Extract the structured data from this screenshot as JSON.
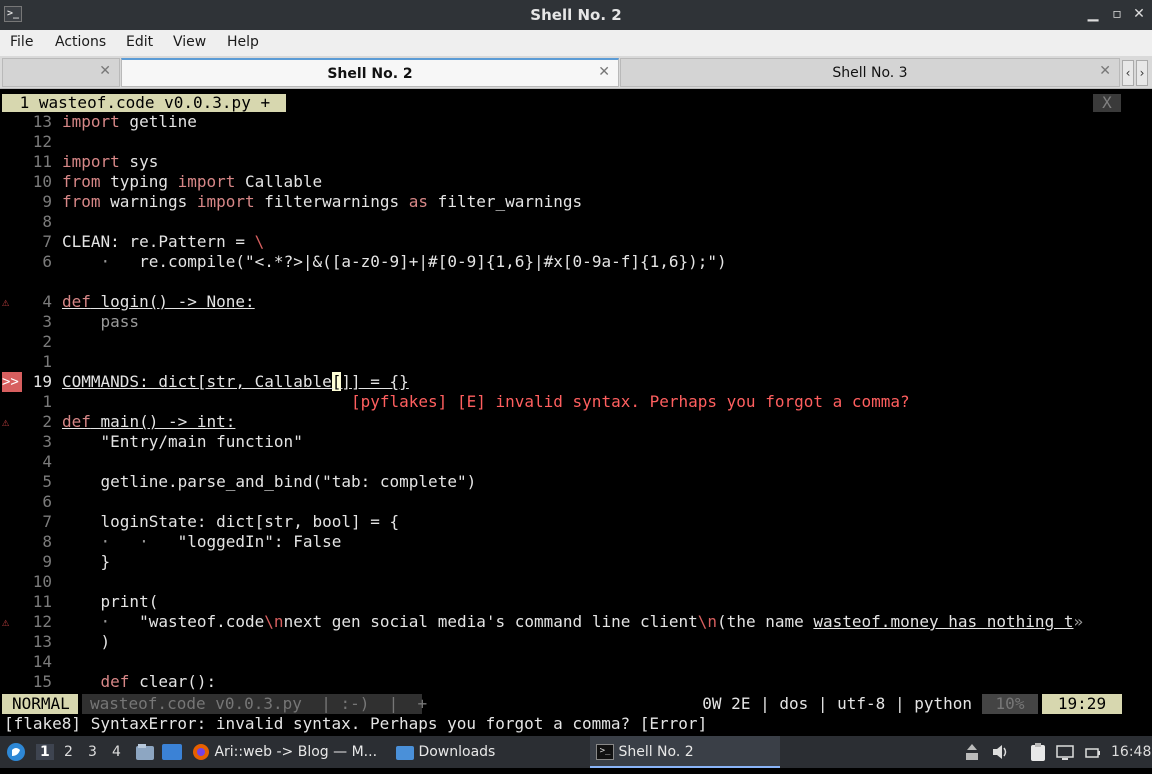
{
  "window": {
    "title": "Shell No. 2"
  },
  "menu": [
    "File",
    "Actions",
    "Edit",
    "View",
    "Help"
  ],
  "tabs": [
    {
      "label": ""
    },
    {
      "label": "Shell No. 2"
    },
    {
      "label": "Shell No. 3"
    }
  ],
  "vim": {
    "bufferline": " 1 wasteof.code v0.0.3.py + ",
    "close_label": "X",
    "lines": [
      {
        "ln": "13",
        "code": "import getline"
      },
      {
        "ln": "12",
        "code": ""
      },
      {
        "ln": "11",
        "code": "import sys"
      },
      {
        "ln": "10",
        "code": "from typing import Callable"
      },
      {
        "ln": "9",
        "code": "from warnings import filterwarnings as filter_warnings"
      },
      {
        "ln": "8",
        "code": ""
      },
      {
        "ln": "7",
        "code": "CLEAN: re.Pattern = \\"
      },
      {
        "ln": "6",
        "code": "    ·   re.compile(\"<.*?>|&([a-z0-9]+|#[0-9]{1,6}|#x[0-9a-f]{1,6});\")"
      },
      {
        "ln": "4",
        "code": "def login() -> None:"
      },
      {
        "ln": "3",
        "code": "    pass"
      },
      {
        "ln": "2",
        "code": ""
      },
      {
        "ln": "1",
        "code": ""
      },
      {
        "ln": "19",
        "code": "COMMANDS: dict[str, Callable[]] = {}"
      },
      {
        "ln": "1",
        "code": "                              [pyflakes] [E] invalid syntax. Perhaps you forgot a comma?"
      },
      {
        "ln": "2",
        "code": "def main() -> int:"
      },
      {
        "ln": "3",
        "code": "    \"\"\"Entry/main function\"\"\""
      },
      {
        "ln": "4",
        "code": ""
      },
      {
        "ln": "5",
        "code": "    getline.parse_and_bind(\"tab: complete\")"
      },
      {
        "ln": "6",
        "code": ""
      },
      {
        "ln": "7",
        "code": "    loginState: dict[str, bool] = {"
      },
      {
        "ln": "8",
        "code": "    ·   ·   \"loggedIn\": False"
      },
      {
        "ln": "9",
        "code": "    }"
      },
      {
        "ln": "10",
        "code": ""
      },
      {
        "ln": "11",
        "code": "    print("
      },
      {
        "ln": "12",
        "code": "    ·   \"wasteof.code\\nnext gen social media's command line client\\n(the name wasteof.money has nothing t»"
      },
      {
        "ln": "13",
        "code": "    )"
      },
      {
        "ln": "14",
        "code": ""
      },
      {
        "ln": "15",
        "code": "    def clear():"
      }
    ],
    "sign": ">>",
    "status": {
      "mode": "NORMAL",
      "file": "wasteof.code v0.0.3.py  | :-)  |  + ",
      "info": "0W 2E | dos | utf-8 | python",
      "percent": "10%",
      "position": "19:29"
    },
    "cmdline": "[flake8] SyntaxError: invalid syntax. Perhaps you forgot a comma? [Error]"
  },
  "taskbar": {
    "workspaces": [
      "1",
      "2",
      "3",
      "4"
    ],
    "apps": [
      {
        "label": "Ari::web -> Blog — M..."
      },
      {
        "label": "Downloads"
      },
      {
        "label": "Shell No. 2"
      }
    ],
    "clock": "16:48"
  }
}
